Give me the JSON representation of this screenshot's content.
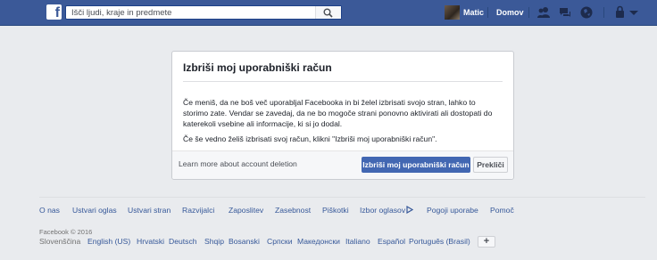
{
  "header": {
    "logo_letter": "f",
    "search_placeholder": "Išči ljudi, kraje in predmete",
    "user_name": "Matic",
    "home_label": "Domov"
  },
  "dialog": {
    "title": "Izbriši moj uporabniški račun",
    "paragraph1": "Če meniš, da ne boš več uporabljal Facebooka in bi želel izbrisati svojo stran, lahko to storimo zate. Vendar se zavedaj, da ne bo mogoče strani ponovno aktivirati ali dostopati do katerekoli vsebine ali informacije, ki si jo dodal.",
    "paragraph2": "Če še vedno želiš izbrisati svoj račun, klikni \"Izbriši moj uporabniški račun\".",
    "learn_more": "Learn more about account deletion",
    "confirm_button": "Izbriši moj uporabniški račun",
    "cancel_button": "Prekliči"
  },
  "footer": {
    "links": [
      "O nas",
      "Ustvari oglas",
      "Ustvari stran",
      "Razvijalci",
      "Zaposlitev",
      "Zasebnost",
      "Piškotki",
      "Izbor oglasov",
      "Pogoji uporabe",
      "Pomoč"
    ],
    "copyright": "Facebook © 2016",
    "current_language": "Slovenščina",
    "languages": [
      "English (US)",
      "Hrvatski",
      "Deutsch",
      "Shqip",
      "Bosanski",
      "Српски",
      "Македонски",
      "Italiano",
      "Español",
      "Português (Brasil)"
    ],
    "more_languages_label": "+"
  },
  "colors": {
    "brand_blue": "#3b5998",
    "button_blue": "#4267b2",
    "link_blue": "#365899",
    "page_background": "#e9ebee"
  }
}
